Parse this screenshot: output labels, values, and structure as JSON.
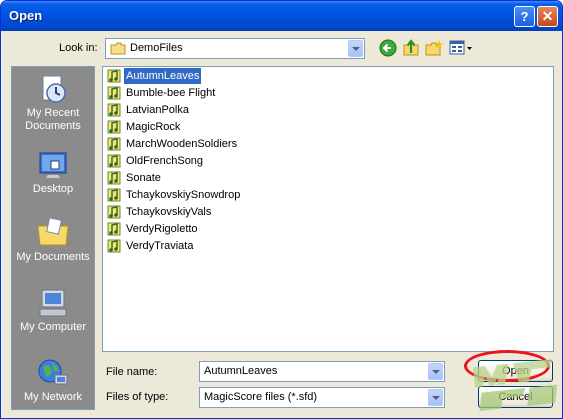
{
  "window": {
    "title": "Open",
    "help_glyph": "?",
    "close_glyph": "✕"
  },
  "lookin": {
    "label": "Look in:",
    "value": "DemoFiles"
  },
  "toolbar": {
    "icons": [
      "back-icon",
      "up-folder-icon",
      "new-folder-icon",
      "views-menu-icon"
    ]
  },
  "places": [
    {
      "label": "My Recent Documents",
      "icon": "recent-documents-icon"
    },
    {
      "label": "Desktop",
      "icon": "desktop-icon"
    },
    {
      "label": "My Documents",
      "icon": "my-documents-icon"
    },
    {
      "label": "My Computer",
      "icon": "my-computer-icon"
    },
    {
      "label": "My Network",
      "icon": "my-network-icon"
    }
  ],
  "files": [
    {
      "name": "AutumnLeaves",
      "selected": true
    },
    {
      "name": "Bumble-bee Flight"
    },
    {
      "name": "LatvianPolka"
    },
    {
      "name": "MagicRock"
    },
    {
      "name": "MarchWoodenSoldiers"
    },
    {
      "name": "OldFrenchSong"
    },
    {
      "name": "Sonate"
    },
    {
      "name": "TchaykovskiySnowdrop"
    },
    {
      "name": "TchaykovskiyVals"
    },
    {
      "name": "VerdyRigoletto"
    },
    {
      "name": "VerdyTraviata"
    }
  ],
  "filename": {
    "label": "File name:",
    "value": "AutumnLeaves"
  },
  "filetype": {
    "label": "Files of type:",
    "value": "MagicScore files (*.sfd)"
  },
  "buttons": {
    "open": "Open",
    "cancel": "Cancel"
  },
  "colors": {
    "titlebar": "#0054e3",
    "selection": "#316ac5",
    "highlight_ring": "#e8141f"
  }
}
